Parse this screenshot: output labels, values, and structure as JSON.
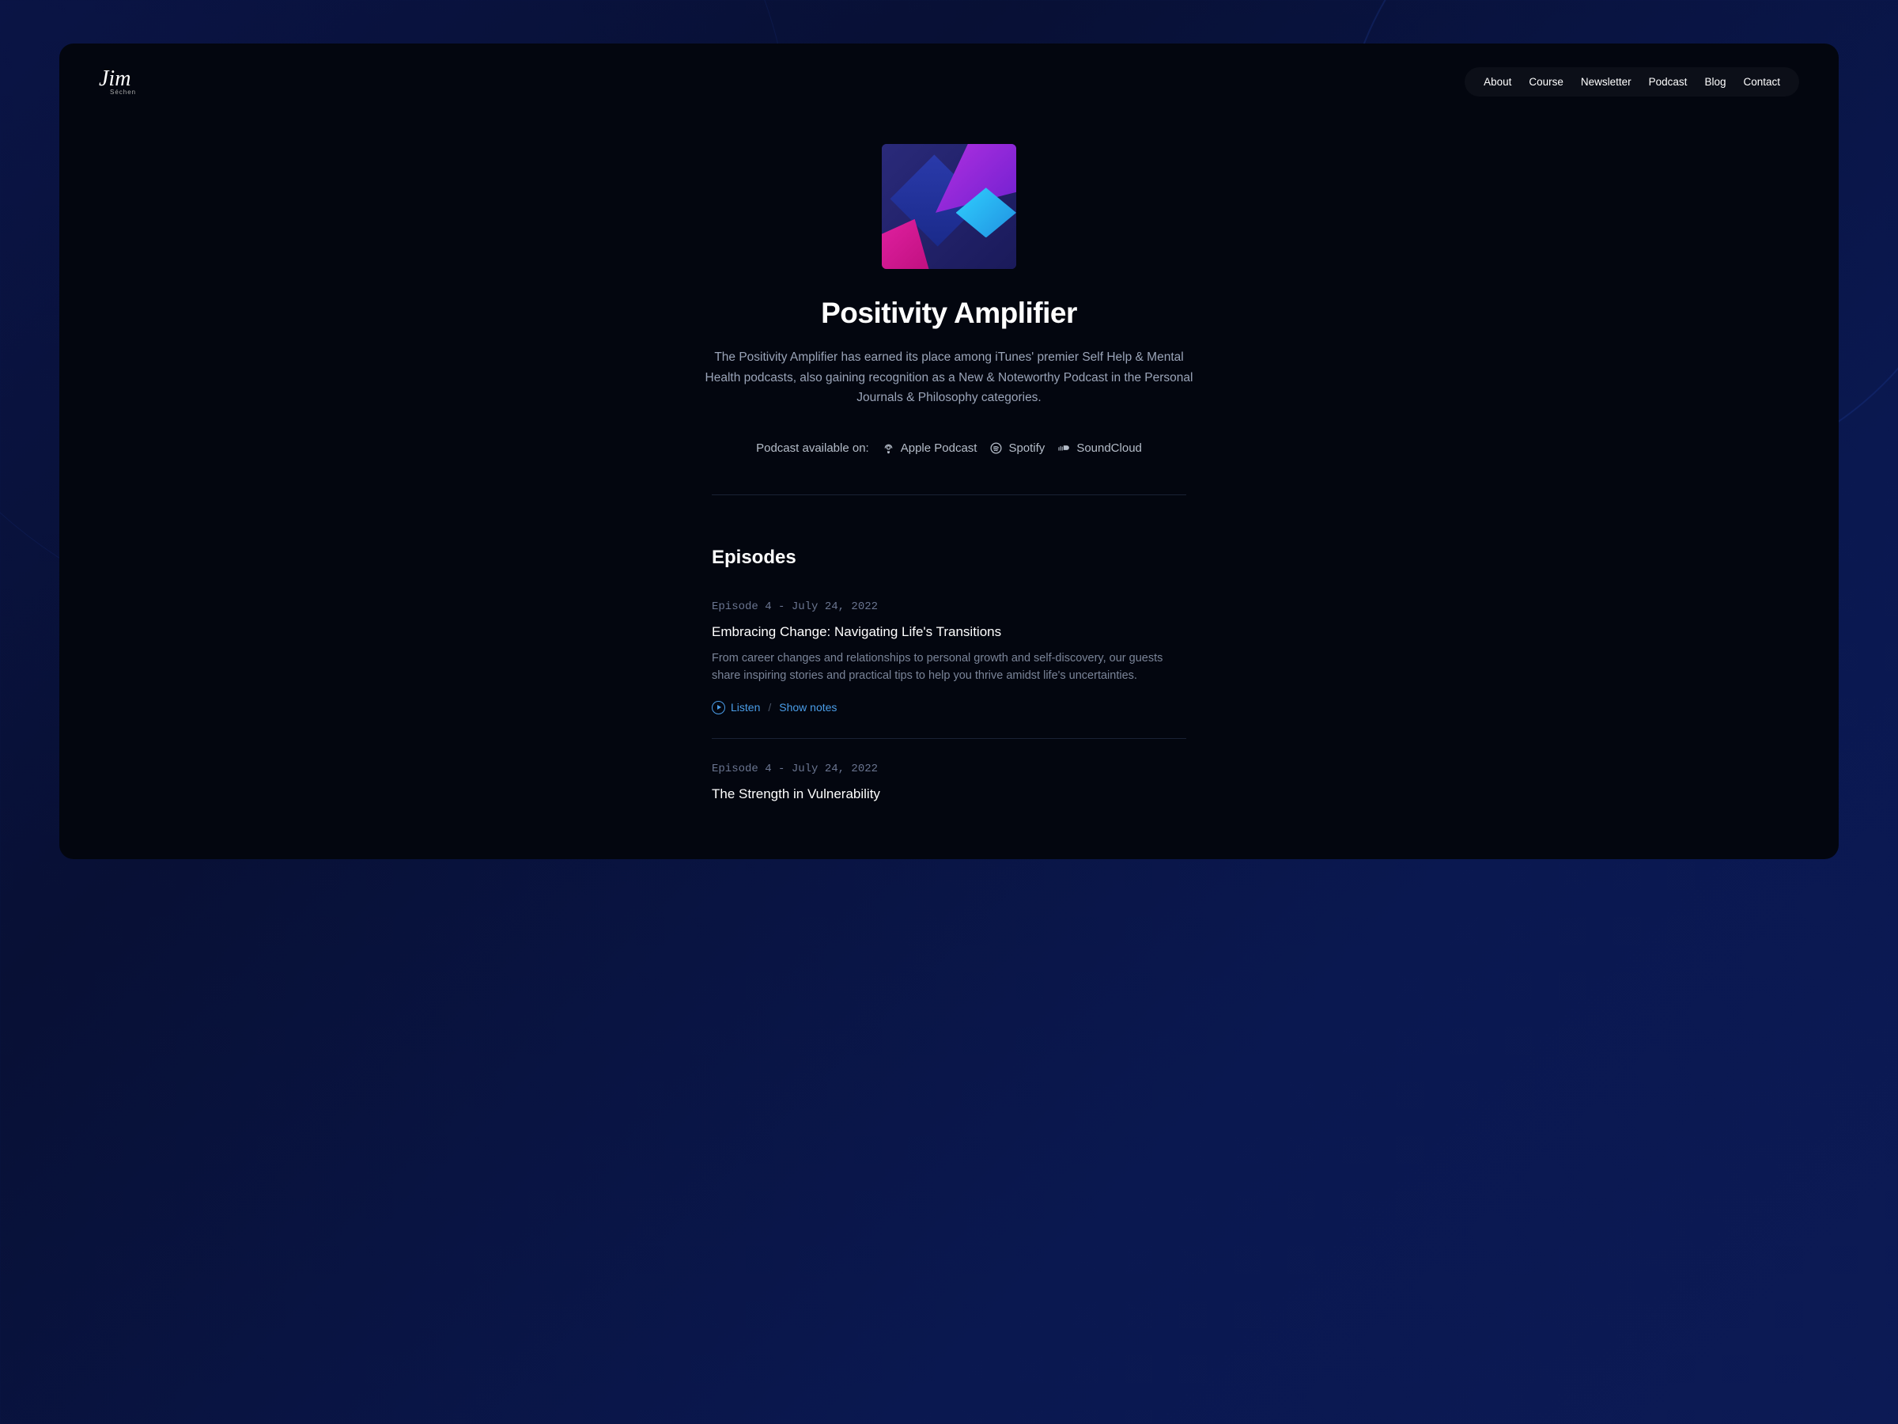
{
  "brand": {
    "name": "Jim",
    "subtitle": "Séchen"
  },
  "nav": {
    "items": [
      "About",
      "Course",
      "Newsletter",
      "Podcast",
      "Blog",
      "Contact"
    ]
  },
  "podcast": {
    "title": "Positivity Amplifier",
    "description": "The Positivity Amplifier has earned its place among iTunes' premier Self Help & Mental Health podcasts, also gaining recognition as a New & Noteworthy Podcast in the Personal Journals & Philosophy categories.",
    "available_label": "Podcast available on:",
    "platforms": [
      {
        "icon": "apple-podcast-icon",
        "label": "Apple Podcast"
      },
      {
        "icon": "spotify-icon",
        "label": "Spotify"
      },
      {
        "icon": "soundcloud-icon",
        "label": "SoundCloud"
      }
    ]
  },
  "episodes": {
    "heading": "Episodes",
    "listen_label": "Listen",
    "notes_label": "Show notes",
    "separator": "/",
    "items": [
      {
        "meta": "Episode 4 - July 24, 2022",
        "title": "Embracing Change: Navigating Life's Transitions",
        "description": "From career changes and relationships to personal growth and self-discovery, our guests share inspiring stories and practical tips to help you thrive amidst life's uncertainties."
      },
      {
        "meta": "Episode 4 - July 24, 2022",
        "title": "The Strength in Vulnerability",
        "description": ""
      }
    ]
  }
}
